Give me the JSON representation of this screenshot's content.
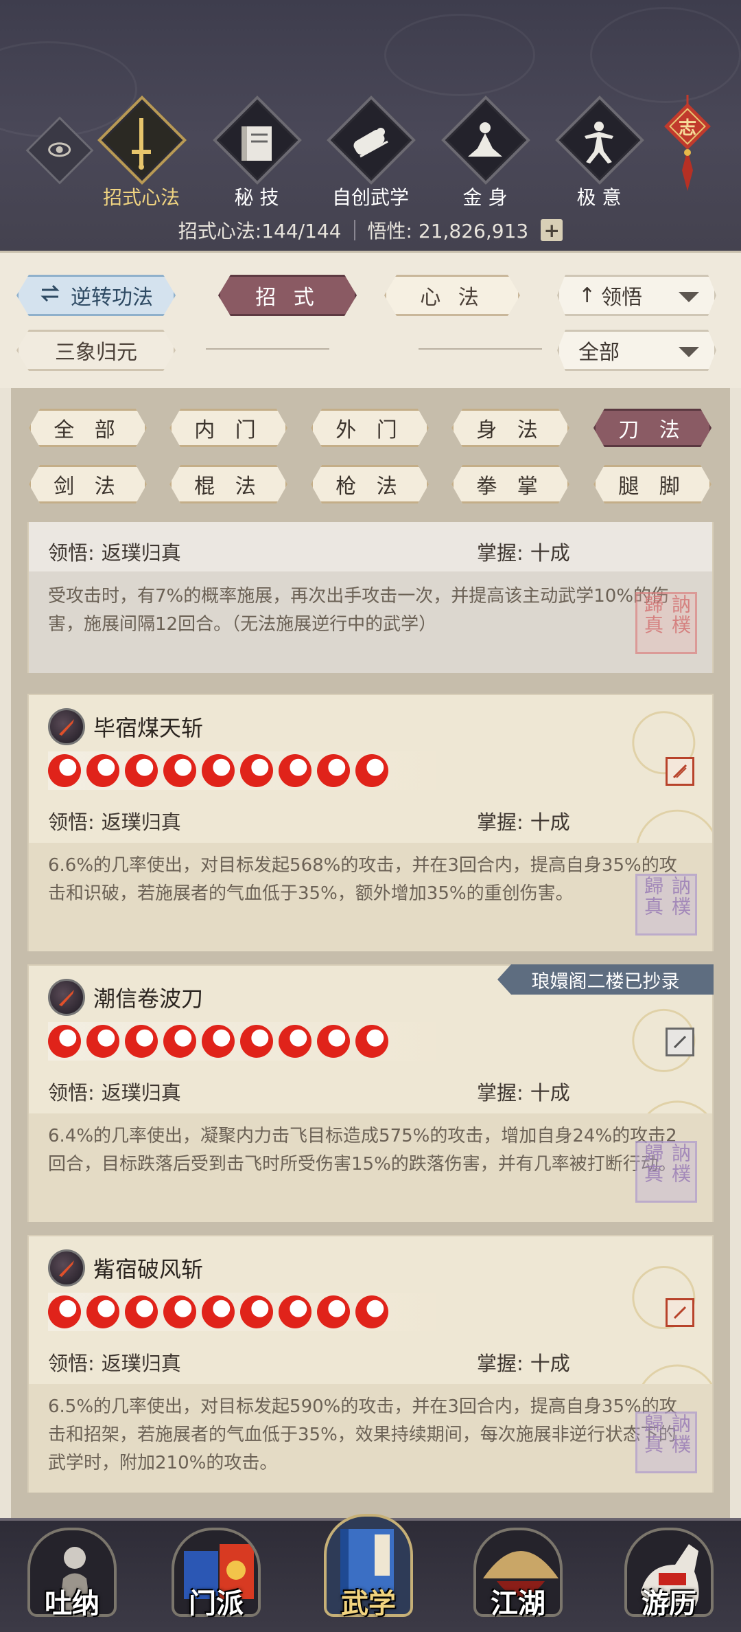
{
  "header": {
    "tabs": [
      {
        "label": "招式心法",
        "icon": "sword-icon",
        "active": true
      },
      {
        "label": "秘 技",
        "icon": "book-icon",
        "active": false
      },
      {
        "label": "自创武学",
        "icon": "scroll-icon",
        "active": false
      },
      {
        "label": "金 身",
        "icon": "meditation-icon",
        "active": false
      },
      {
        "label": "极 意",
        "icon": "martial-stance-icon",
        "active": false
      }
    ],
    "talisman_char": "志",
    "stats": {
      "moves_label": "招式心法:",
      "moves_value": "144/144",
      "insight_label": "悟性:",
      "insight_value": "21,826,913",
      "plus": "+"
    }
  },
  "filters": {
    "reverse_label": "逆转功法",
    "moves_tab": "招 式",
    "heart_tab": "心 法",
    "sort_label": "领悟",
    "sanxiang_label": "三象归元",
    "scope_label": "全部"
  },
  "categories": [
    "全 部",
    "内 门",
    "外 门",
    "身 法",
    "刀 法",
    "剑 法",
    "棍 法",
    "枪 法",
    "拳 掌",
    "腿 脚"
  ],
  "active_category": "刀 法",
  "skills": [
    {
      "name": "",
      "comprehension_label": "领悟:",
      "comprehension": "返璞归真",
      "mastery_label": "掌握:",
      "mastery": "十成",
      "description": "受攻击时，有7%的概率施展，再次出手攻击一次，并提高该主动武学10%的伤害，施展间隔12回合。（无法施展逆行中的武学）",
      "stars": 0
    },
    {
      "name": "毕宿煤天斩",
      "comprehension_label": "领悟:",
      "comprehension": "返璞归真",
      "mastery_label": "掌握:",
      "mastery": "十成",
      "description": "6.6%的几率使出，对目标发起568%的攻击，并在3回合内，提高自身35%的攻击和识破，若施展者的气血低于35%，额外增加35%的重创伤害。",
      "stars": 9
    },
    {
      "name": "潮信卷波刀",
      "comprehension_label": "领悟:",
      "comprehension": "返璞归真",
      "mastery_label": "掌握:",
      "mastery": "十成",
      "description": "6.4%的几率使出，凝聚内力击飞目标造成575%的攻击，增加自身24%的攻击2回合，目标跌落后受到击飞时所受伤害15%的跌落伤害，并有几率被打断行动。",
      "stars": 9,
      "ribbon": "琅嬛阁二楼已抄录"
    },
    {
      "name": "觜宿破风斩",
      "comprehension_label": "领悟:",
      "comprehension": "返璞归真",
      "mastery_label": "掌握:",
      "mastery": "十成",
      "description": "6.5%的几率使出，对目标发起590%的攻击，并在3回合内，提高自身35%的攻击和招架，若施展者的气血低于35%，效果持续期间，每次施展非逆行状态下的武学时，附加210%的攻击。",
      "stars": 9
    }
  ],
  "seal_text": "訥樸 歸真",
  "bottom_nav": [
    {
      "label": "吐纳",
      "icon": "figure-icon",
      "active": false
    },
    {
      "label": "门派",
      "icon": "sect-banner-icon",
      "active": false
    },
    {
      "label": "武学",
      "icon": "martial-book-icon",
      "active": true
    },
    {
      "label": "江湖",
      "icon": "bamboo-hat-icon",
      "active": false
    },
    {
      "label": "游历",
      "icon": "horse-icon",
      "active": false
    }
  ]
}
